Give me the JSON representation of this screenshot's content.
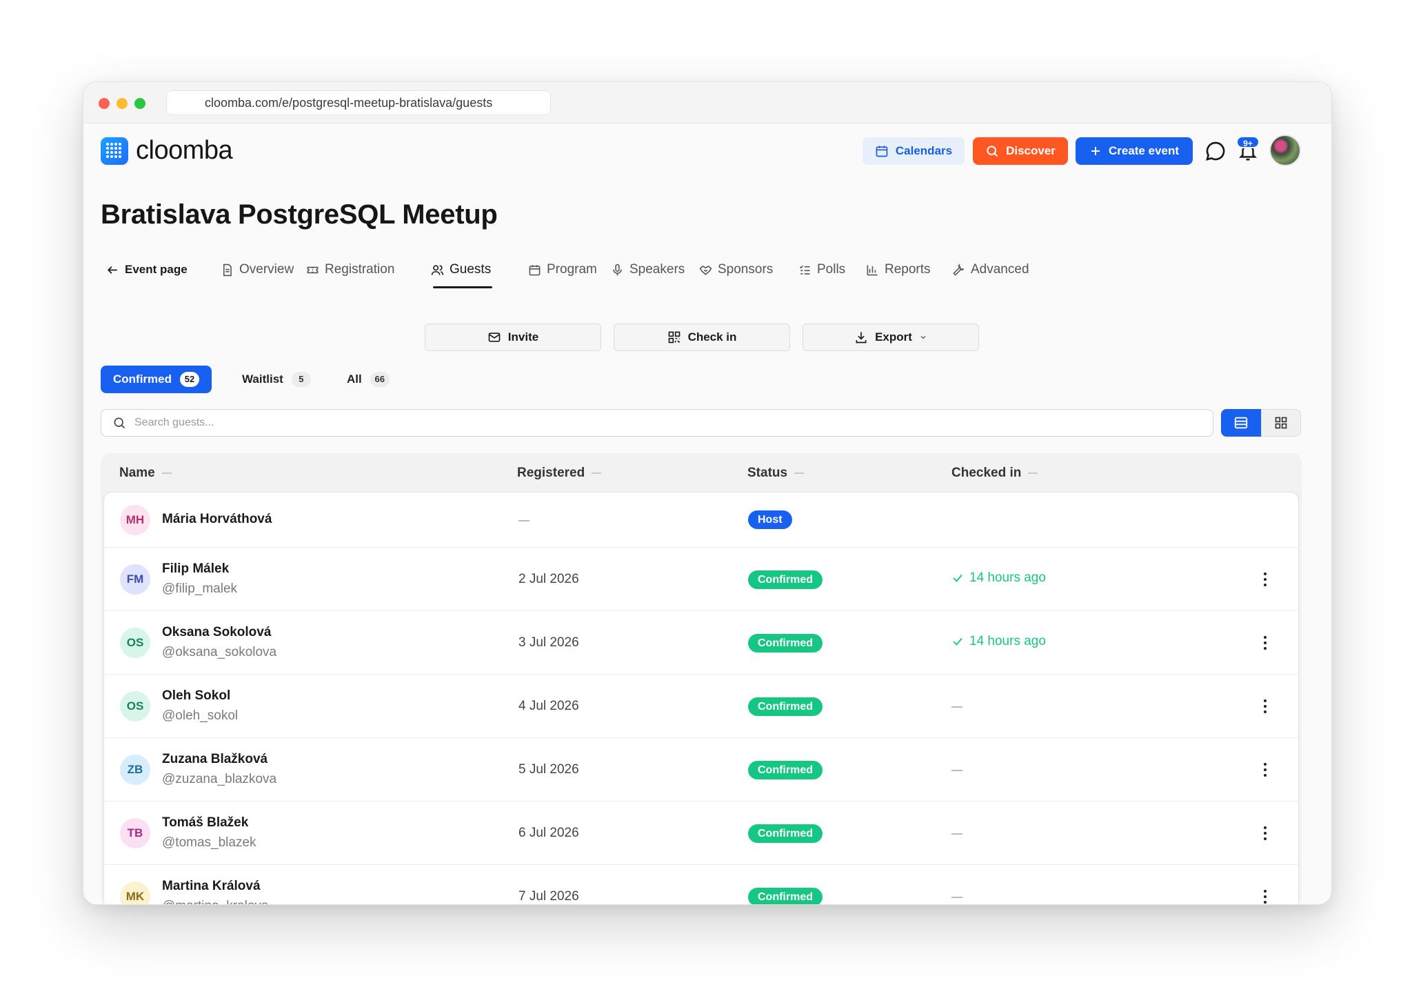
{
  "browser": {
    "url": "cloomba.com/e/postgresql-meetup-bratislava/guests"
  },
  "header": {
    "logo_text": "cloomba",
    "calendars_label": "Calendars",
    "discover_label": "Discover",
    "create_label": "Create event",
    "notification_badge": "9+"
  },
  "page": {
    "title": "Bratislava PostgreSQL Meetup"
  },
  "nav": {
    "back": "Event page",
    "tabs": [
      "Overview",
      "Registration",
      "Guests",
      "Program",
      "Speakers",
      "Sponsors",
      "Polls",
      "Reports",
      "Advanced"
    ],
    "active_tab": "Guests"
  },
  "actions": {
    "invite": "Invite",
    "checkin": "Check in",
    "export": "Export"
  },
  "filters": [
    {
      "label": "Confirmed",
      "count": "52"
    },
    {
      "label": "Waitlist",
      "count": "5"
    },
    {
      "label": "All",
      "count": "66"
    }
  ],
  "search": {
    "placeholder": "Search guests..."
  },
  "table": {
    "columns": [
      "Name",
      "Registered",
      "Status",
      "Checked in"
    ],
    "rows": [
      {
        "initials": "MH",
        "name": "Mária Horváthová",
        "handle": "",
        "registered": "—",
        "status": "Host",
        "checked_in": ""
      },
      {
        "initials": "FM",
        "name": "Filip Málek",
        "handle": "@filip_malek",
        "registered": "2 Jul 2026",
        "status": "Confirmed",
        "checked_in": "14 hours ago"
      },
      {
        "initials": "OS",
        "name": "Oksana Sokolová",
        "handle": "@oksana_sokolova",
        "registered": "3 Jul 2026",
        "status": "Confirmed",
        "checked_in": "14 hours ago"
      },
      {
        "initials": "OS",
        "name": "Oleh Sokol",
        "handle": "@oleh_sokol",
        "registered": "4 Jul 2026",
        "status": "Confirmed",
        "checked_in": "—"
      },
      {
        "initials": "ZB",
        "name": "Zuzana Blažková",
        "handle": "@zuzana_blazkova",
        "registered": "5 Jul 2026",
        "status": "Confirmed",
        "checked_in": "—"
      },
      {
        "initials": "TB",
        "name": "Tomáš Blažek",
        "handle": "@tomas_blazek",
        "registered": "6 Jul 2026",
        "status": "Confirmed",
        "checked_in": "—"
      },
      {
        "initials": "MK",
        "name": "Martina Králová",
        "handle": "@martina_kralova",
        "registered": "7 Jul 2026",
        "status": "Confirmed",
        "checked_in": "—"
      }
    ]
  },
  "colors": {
    "primary": "#1760f0",
    "discover": "#ff5722",
    "success": "#16c784"
  },
  "icons": {
    "calendars": "calendar-icon",
    "discover": "search-icon",
    "create": "plus-icon",
    "chat": "chat-bubble-icon",
    "notifications": "bell-icon",
    "row_menu": "kebab-menu-icon"
  }
}
